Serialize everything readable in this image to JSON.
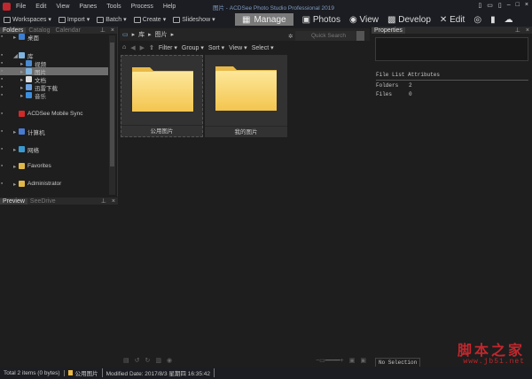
{
  "window": {
    "title": "图片 - ACDSee Photo Studio Professional 2019"
  },
  "menu": [
    "File",
    "Edit",
    "View",
    "Panes",
    "Tools",
    "Process",
    "Help"
  ],
  "toolbar": [
    "Workspaces",
    "Import",
    "Batch",
    "Create",
    "Slideshow"
  ],
  "modes": [
    "Manage",
    "Photos",
    "View",
    "Develop",
    "Edit"
  ],
  "left_tabs": [
    "Folders",
    "Catalog",
    "Calendar"
  ],
  "tree": [
    {
      "label": "桌面",
      "color": "#3c7fd0"
    },
    {
      "label": "库",
      "color": "#7fb4e0"
    },
    {
      "label": "视频",
      "color": "#4a8ad0"
    },
    {
      "label": "图片",
      "color": "#7fb4e0"
    },
    {
      "label": "文档",
      "color": "#ddd"
    },
    {
      "label": "迅雷下载",
      "color": "#6aa0e0"
    },
    {
      "label": "音乐",
      "color": "#3c8fe0"
    },
    {
      "label": "ACDSee Mobile Sync",
      "color": "#d02a2a"
    },
    {
      "label": "计算机",
      "color": "#4a7ad0"
    },
    {
      "label": "网络",
      "color": "#3a9ad0"
    },
    {
      "label": "Favorites",
      "color": "#e0b84a"
    },
    {
      "label": "Administrator",
      "color": "#e0b84a"
    }
  ],
  "preview_tabs": [
    "Preview",
    "SeeDrive"
  ],
  "breadcrumb": [
    "库",
    "图片"
  ],
  "quick_search_placeholder": "Quick Search",
  "nav": [
    "Filter",
    "Group",
    "Sort",
    "View",
    "Select"
  ],
  "files": [
    {
      "name": "公用图片"
    },
    {
      "name": "我的图片"
    }
  ],
  "properties": {
    "title": "Properties",
    "section": "File List Attributes",
    "rows": [
      {
        "k": "Folders",
        "v": "2"
      },
      {
        "k": "Files",
        "v": "0"
      }
    ],
    "tab": "No Selection"
  },
  "status": {
    "total": "Total 2 items  (0 bytes)",
    "folder": "公用图片",
    "modified": "Modified Date: 2017/8/3 星期四 16:35:42"
  },
  "watermark": {
    "cn": "脚本之家",
    "url": "www.jb51.net"
  }
}
